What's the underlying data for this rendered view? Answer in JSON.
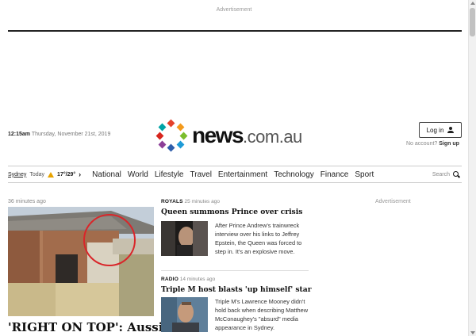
{
  "ads": {
    "top_label": "Advertisement",
    "side_label": "Advertisement"
  },
  "header": {
    "time": "12:15am",
    "date": "Thursday, November 21st, 2019",
    "logo_main": "news",
    "logo_suffix": ".com.au",
    "login_label": "Log in",
    "no_account": "No account?",
    "signup_label": "Sign up"
  },
  "weather": {
    "city": "Sydney",
    "day": "Today",
    "temps": "17°/29°",
    "icon": "sun-icon"
  },
  "nav": {
    "items": [
      "National",
      "World",
      "Lifestyle",
      "Travel",
      "Entertainment",
      "Technology",
      "Finance",
      "Sport"
    ],
    "search_label": "Search"
  },
  "lead": {
    "time": "36 minutes ago",
    "title": "'RIGHT ON TOP': Aussie"
  },
  "stories": [
    {
      "section": "ROYALS",
      "time": "25 minutes ago",
      "headline": "Queen summons Prince over crisis",
      "summary": "After Prince Andrew's trainwreck interview over his links to Jeffrey Epstein, the Queen was forced to step in. It's an explosive move."
    },
    {
      "section": "RADIO",
      "time": "14 minutes ago",
      "headline": "Triple M host blasts 'up himself' star",
      "summary": "Triple M's Lawrence Mooney didn't hold back when describing Matthew McConaughey's \"absurd\" media appearance in Sydney."
    }
  ],
  "colors": {
    "logo_dots": [
      "#e4412c",
      "#f39a1c",
      "#7bbd2c",
      "#1e9bd7",
      "#2f5eab",
      "#8c3f98",
      "#d7261e",
      "#00a3a6"
    ]
  }
}
